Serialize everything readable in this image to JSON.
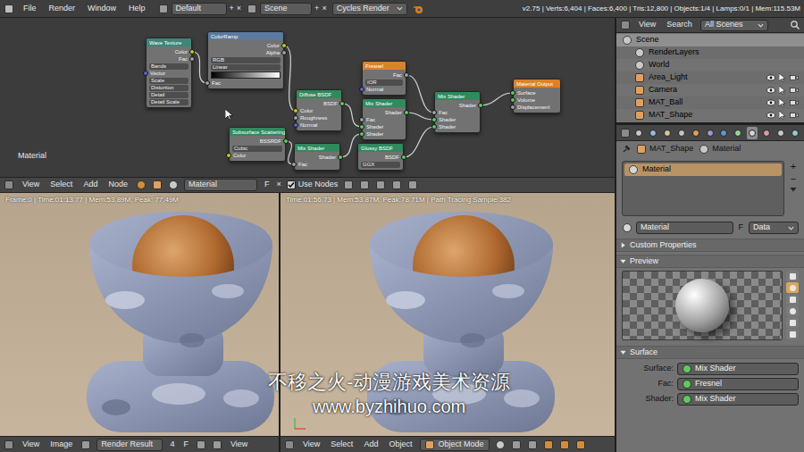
{
  "topbar": {
    "menus": [
      "File",
      "Render",
      "Window",
      "Help"
    ],
    "layout": "Default",
    "scene": "Scene",
    "add": "+",
    "close": "×",
    "engine": "Cycles Render",
    "stats": "v2.75 | Verts:6,404 | Faces:6,400 | Tris:12,800 | Objects:1/4 | Lamps:0/1 | Mem:115.53M"
  },
  "node_editor": {
    "label": "Material",
    "nodes": [
      {
        "title": "Wave Texture",
        "color": "#3d8578",
        "rows": [
          {
            "kind": "output",
            "text": "Color",
            "color": "#c7c729"
          },
          {
            "kind": "output",
            "text": "Fac",
            "color": "#a1a1a1"
          },
          {
            "kind": "field",
            "text": "Bands"
          },
          {
            "kind": "input",
            "text": "Vector",
            "color": "#6363c7"
          },
          {
            "kind": "field",
            "text": "Scale"
          },
          {
            "kind": "field",
            "text": "Distortion"
          },
          {
            "kind": "field",
            "text": "Detail"
          },
          {
            "kind": "field",
            "text": "Detail Scale"
          }
        ]
      },
      {
        "title": "ColorRamp",
        "color": "#5a7aa0",
        "rows": [
          {
            "kind": "output",
            "text": "Color",
            "color": "#c7c729"
          },
          {
            "kind": "output",
            "text": "Alpha",
            "color": "#a1a1a1"
          },
          {
            "kind": "field",
            "text": "RGB"
          },
          {
            "kind": "field",
            "text": "Linear"
          },
          {
            "kind": "ramp"
          },
          {
            "kind": "input",
            "text": "Fac",
            "color": "#a1a1a1"
          }
        ]
      },
      {
        "title": "Diffuse BSDF",
        "color": "#2f8a5e",
        "rows": [
          {
            "kind": "output",
            "text": "BSDF",
            "color": "#63c763"
          },
          {
            "kind": "input",
            "text": "Color",
            "color": "#c7c729"
          },
          {
            "kind": "input",
            "text": "Roughness",
            "color": "#a1a1a1"
          },
          {
            "kind": "input",
            "text": "Normal",
            "color": "#6363c7"
          }
        ]
      },
      {
        "title": "Fresnel",
        "color": "#d9822b",
        "rows": [
          {
            "kind": "output",
            "text": "Fac",
            "color": "#a1a1a1"
          },
          {
            "kind": "field",
            "text": "IOR"
          },
          {
            "kind": "input",
            "text": "Normal",
            "color": "#6363c7"
          }
        ]
      },
      {
        "title": "Mix Shader",
        "color": "#2f8a5e",
        "rows": [
          {
            "kind": "output",
            "text": "Shader",
            "color": "#63c763"
          },
          {
            "kind": "input",
            "text": "Fac",
            "color": "#a1a1a1"
          },
          {
            "kind": "input",
            "text": "Shader",
            "color": "#63c763"
          },
          {
            "kind": "input",
            "text": "Shader",
            "color": "#63c763"
          }
        ]
      },
      {
        "title": "Mix Shader",
        "color": "#2f8a5e",
        "rows": [
          {
            "kind": "output",
            "text": "Shader",
            "color": "#63c763"
          },
          {
            "kind": "input",
            "text": "Fac",
            "color": "#a1a1a1"
          },
          {
            "kind": "input",
            "text": "Shader",
            "color": "#63c763"
          },
          {
            "kind": "input",
            "text": "Shader",
            "color": "#63c763"
          }
        ]
      },
      {
        "title": "Material Output",
        "color": "#d9822b",
        "rows": [
          {
            "kind": "input",
            "text": "Surface",
            "color": "#63c763"
          },
          {
            "kind": "input",
            "text": "Volume",
            "color": "#63c763"
          },
          {
            "kind": "input",
            "text": "Displacement",
            "color": "#a1a1a1"
          }
        ]
      },
      {
        "title": "Subsurface Scattering",
        "color": "#2f8a5e",
        "rows": [
          {
            "kind": "output",
            "text": "BSSRDF",
            "color": "#63c763"
          },
          {
            "kind": "field",
            "text": "Cubic"
          },
          {
            "kind": "input",
            "text": "Color",
            "color": "#c7c729"
          }
        ]
      },
      {
        "title": "Mix Shader",
        "color": "#2f8a5e",
        "rows": [
          {
            "kind": "output",
            "text": "Shader",
            "color": "#63c763"
          },
          {
            "kind": "input",
            "text": "Fac",
            "color": "#a1a1a1"
          }
        ]
      },
      {
        "title": "Glossy BSDF",
        "color": "#2f8a5e",
        "rows": [
          {
            "kind": "output",
            "text": "BSDF",
            "color": "#63c763"
          },
          {
            "kind": "field",
            "text": "GGX"
          }
        ]
      }
    ]
  },
  "node_header": {
    "menus": [
      "View",
      "Select",
      "Add",
      "Node"
    ],
    "material": "Material",
    "fake_user": "F",
    "close": "×",
    "use_nodes": {
      "label": "Use Nodes",
      "checked": true
    }
  },
  "image_editor": {
    "info": "Frame:0 | Time:01:13.77 | Mem:53.89M, Peak: 77.49M",
    "menus": [
      "View",
      "Image"
    ],
    "image": "Render Result",
    "users": "4",
    "fake_user": "F",
    "extra_menu": "View"
  },
  "view3d": {
    "info": "Time:01:56.73 | Mem:53.87M, Peak:78.71M | Path Tracing Sample 382",
    "menus": [
      "View",
      "Select",
      "Add",
      "Object"
    ],
    "mode": "Object Mode"
  },
  "outliner": {
    "menus": [
      "View",
      "Search"
    ],
    "filter": "All Scenes",
    "items": [
      {
        "label": "Scene",
        "kind": "scene",
        "depth": 0,
        "selected": true
      },
      {
        "label": "RenderLayers",
        "kind": "data",
        "depth": 1,
        "selected": false
      },
      {
        "label": "World",
        "kind": "data",
        "depth": 1,
        "selected": false
      },
      {
        "label": "Area_Light",
        "kind": "object",
        "depth": 1,
        "selected": false
      },
      {
        "label": "Camera",
        "kind": "object",
        "depth": 1,
        "selected": false
      },
      {
        "label": "MAT_Ball",
        "kind": "object",
        "depth": 1,
        "selected": false
      },
      {
        "label": "MAT_Shape",
        "kind": "object",
        "depth": 1,
        "selected": false
      }
    ]
  },
  "properties": {
    "tabs": [
      {
        "selected": false
      },
      {
        "selected": false
      },
      {
        "selected": false
      },
      {
        "selected": false
      },
      {
        "selected": false
      },
      {
        "selected": false
      },
      {
        "selected": false
      },
      {
        "selected": false
      },
      {
        "selected": true
      },
      {
        "selected": false
      },
      {
        "selected": false
      },
      {
        "selected": false
      }
    ],
    "breadcrumb": [
      "MAT_Shape",
      "Material"
    ],
    "slots": [
      {
        "label": "Material",
        "selected": true
      }
    ],
    "slot_buttons": [
      "+",
      "−"
    ],
    "material_field": "Material",
    "fake_user": "F",
    "link": "Data",
    "panels": [
      {
        "title": "Custom Properties",
        "kind": "custom",
        "expanded": false
      },
      {
        "title": "Preview",
        "kind": "preview",
        "expanded": true
      },
      {
        "title": "Surface",
        "kind": "surface",
        "expanded": true
      }
    ],
    "preview_shapes": [
      {
        "selected": false
      },
      {
        "selected": true
      },
      {
        "selected": false
      },
      {
        "selected": false
      },
      {
        "selected": false
      },
      {
        "selected": false
      }
    ],
    "surface_fields": [
      {
        "label": "Surface:",
        "value": "Mix Shader"
      },
      {
        "label": "Fac:",
        "value": "Fresnel"
      },
      {
        "label": "Shader:",
        "value": "Mix Shader"
      }
    ]
  },
  "watermark": {
    "line1": "不移之火-动漫游戏美术资源",
    "line2": "www.byzhihuo.com"
  }
}
